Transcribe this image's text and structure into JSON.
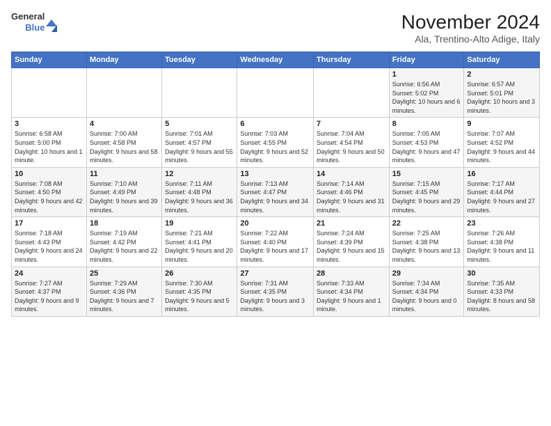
{
  "header": {
    "logo_line1": "General",
    "logo_line2": "Blue",
    "month": "November 2024",
    "location": "Ala, Trentino-Alto Adige, Italy"
  },
  "weekdays": [
    "Sunday",
    "Monday",
    "Tuesday",
    "Wednesday",
    "Thursday",
    "Friday",
    "Saturday"
  ],
  "weeks": [
    [
      {
        "day": "",
        "info": ""
      },
      {
        "day": "",
        "info": ""
      },
      {
        "day": "",
        "info": ""
      },
      {
        "day": "",
        "info": ""
      },
      {
        "day": "",
        "info": ""
      },
      {
        "day": "1",
        "info": "Sunrise: 6:56 AM\nSunset: 5:02 PM\nDaylight: 10 hours and 6 minutes."
      },
      {
        "day": "2",
        "info": "Sunrise: 6:57 AM\nSunset: 5:01 PM\nDaylight: 10 hours and 3 minutes."
      }
    ],
    [
      {
        "day": "3",
        "info": "Sunrise: 6:58 AM\nSunset: 5:00 PM\nDaylight: 10 hours and 1 minute."
      },
      {
        "day": "4",
        "info": "Sunrise: 7:00 AM\nSunset: 4:58 PM\nDaylight: 9 hours and 58 minutes."
      },
      {
        "day": "5",
        "info": "Sunrise: 7:01 AM\nSunset: 4:57 PM\nDaylight: 9 hours and 55 minutes."
      },
      {
        "day": "6",
        "info": "Sunrise: 7:03 AM\nSunset: 4:55 PM\nDaylight: 9 hours and 52 minutes."
      },
      {
        "day": "7",
        "info": "Sunrise: 7:04 AM\nSunset: 4:54 PM\nDaylight: 9 hours and 50 minutes."
      },
      {
        "day": "8",
        "info": "Sunrise: 7:05 AM\nSunset: 4:53 PM\nDaylight: 9 hours and 47 minutes."
      },
      {
        "day": "9",
        "info": "Sunrise: 7:07 AM\nSunset: 4:52 PM\nDaylight: 9 hours and 44 minutes."
      }
    ],
    [
      {
        "day": "10",
        "info": "Sunrise: 7:08 AM\nSunset: 4:50 PM\nDaylight: 9 hours and 42 minutes."
      },
      {
        "day": "11",
        "info": "Sunrise: 7:10 AM\nSunset: 4:49 PM\nDaylight: 9 hours and 39 minutes."
      },
      {
        "day": "12",
        "info": "Sunrise: 7:11 AM\nSunset: 4:48 PM\nDaylight: 9 hours and 36 minutes."
      },
      {
        "day": "13",
        "info": "Sunrise: 7:13 AM\nSunset: 4:47 PM\nDaylight: 9 hours and 34 minutes."
      },
      {
        "day": "14",
        "info": "Sunrise: 7:14 AM\nSunset: 4:46 PM\nDaylight: 9 hours and 31 minutes."
      },
      {
        "day": "15",
        "info": "Sunrise: 7:15 AM\nSunset: 4:45 PM\nDaylight: 9 hours and 29 minutes."
      },
      {
        "day": "16",
        "info": "Sunrise: 7:17 AM\nSunset: 4:44 PM\nDaylight: 9 hours and 27 minutes."
      }
    ],
    [
      {
        "day": "17",
        "info": "Sunrise: 7:18 AM\nSunset: 4:43 PM\nDaylight: 9 hours and 24 minutes."
      },
      {
        "day": "18",
        "info": "Sunrise: 7:19 AM\nSunset: 4:42 PM\nDaylight: 9 hours and 22 minutes."
      },
      {
        "day": "19",
        "info": "Sunrise: 7:21 AM\nSunset: 4:41 PM\nDaylight: 9 hours and 20 minutes."
      },
      {
        "day": "20",
        "info": "Sunrise: 7:22 AM\nSunset: 4:40 PM\nDaylight: 9 hours and 17 minutes."
      },
      {
        "day": "21",
        "info": "Sunrise: 7:24 AM\nSunset: 4:39 PM\nDaylight: 9 hours and 15 minutes."
      },
      {
        "day": "22",
        "info": "Sunrise: 7:25 AM\nSunset: 4:38 PM\nDaylight: 9 hours and 13 minutes."
      },
      {
        "day": "23",
        "info": "Sunrise: 7:26 AM\nSunset: 4:38 PM\nDaylight: 9 hours and 11 minutes."
      }
    ],
    [
      {
        "day": "24",
        "info": "Sunrise: 7:27 AM\nSunset: 4:37 PM\nDaylight: 9 hours and 9 minutes."
      },
      {
        "day": "25",
        "info": "Sunrise: 7:29 AM\nSunset: 4:36 PM\nDaylight: 9 hours and 7 minutes."
      },
      {
        "day": "26",
        "info": "Sunrise: 7:30 AM\nSunset: 4:35 PM\nDaylight: 9 hours and 5 minutes."
      },
      {
        "day": "27",
        "info": "Sunrise: 7:31 AM\nSunset: 4:35 PM\nDaylight: 9 hours and 3 minutes."
      },
      {
        "day": "28",
        "info": "Sunrise: 7:33 AM\nSunset: 4:34 PM\nDaylight: 9 hours and 1 minute."
      },
      {
        "day": "29",
        "info": "Sunrise: 7:34 AM\nSunset: 4:34 PM\nDaylight: 9 hours and 0 minutes."
      },
      {
        "day": "30",
        "info": "Sunrise: 7:35 AM\nSunset: 4:33 PM\nDaylight: 8 hours and 58 minutes."
      }
    ]
  ]
}
